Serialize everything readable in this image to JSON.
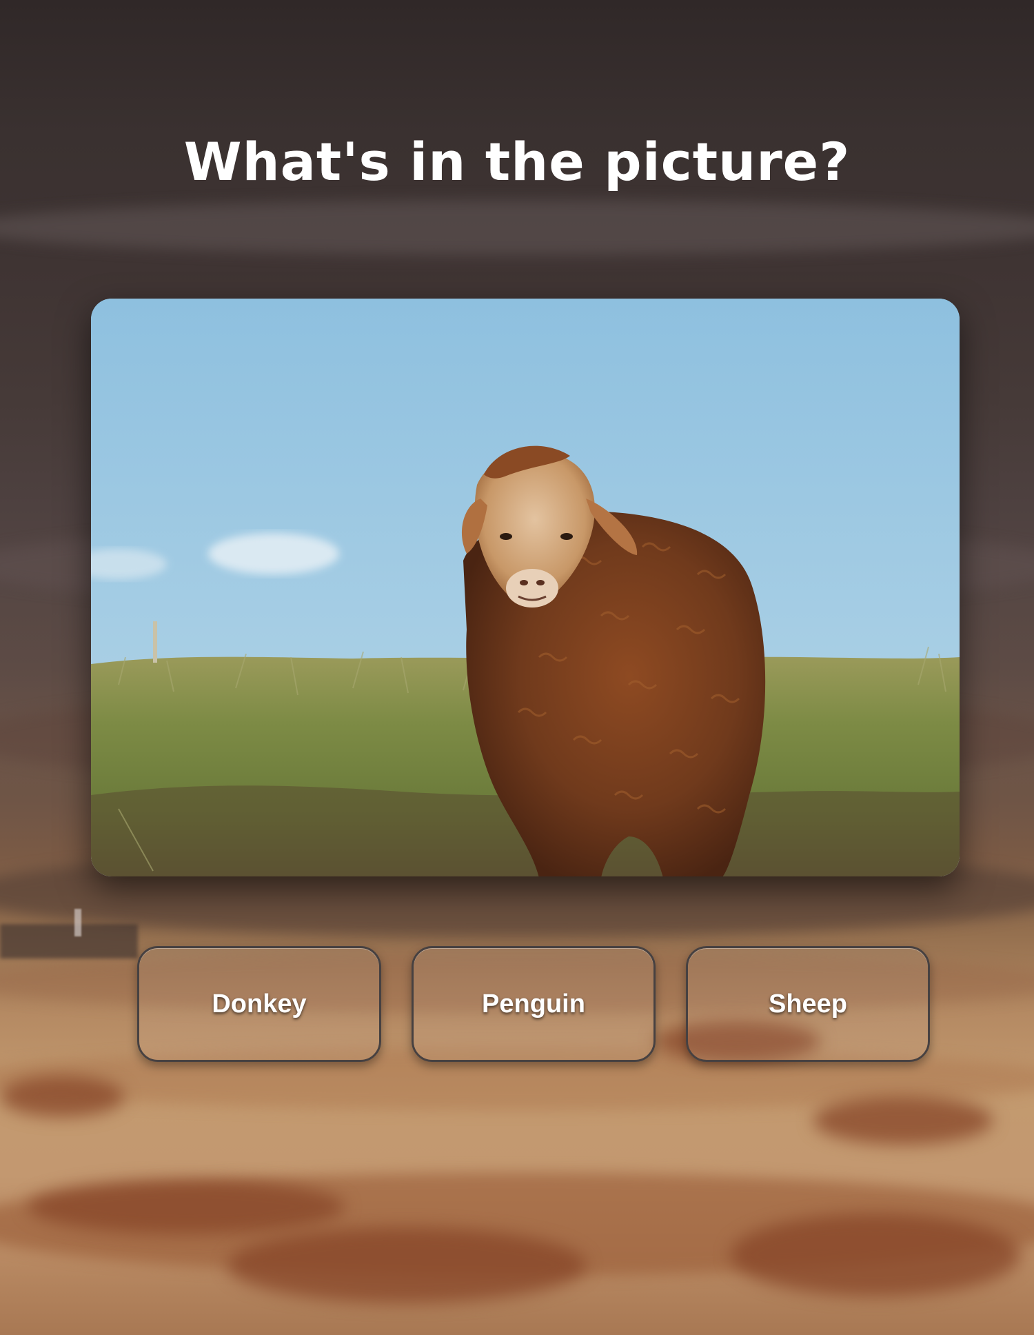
{
  "question": {
    "title": "What's in the picture?"
  },
  "picture": {
    "subject_icon": "sheep-photo",
    "sky_color": "#9fcae4",
    "grass_color": "#7e8b45",
    "wool_color": "#7a3f1e"
  },
  "answers": [
    {
      "label": "Donkey"
    },
    {
      "label": "Penguin"
    },
    {
      "label": "Sheep"
    }
  ]
}
